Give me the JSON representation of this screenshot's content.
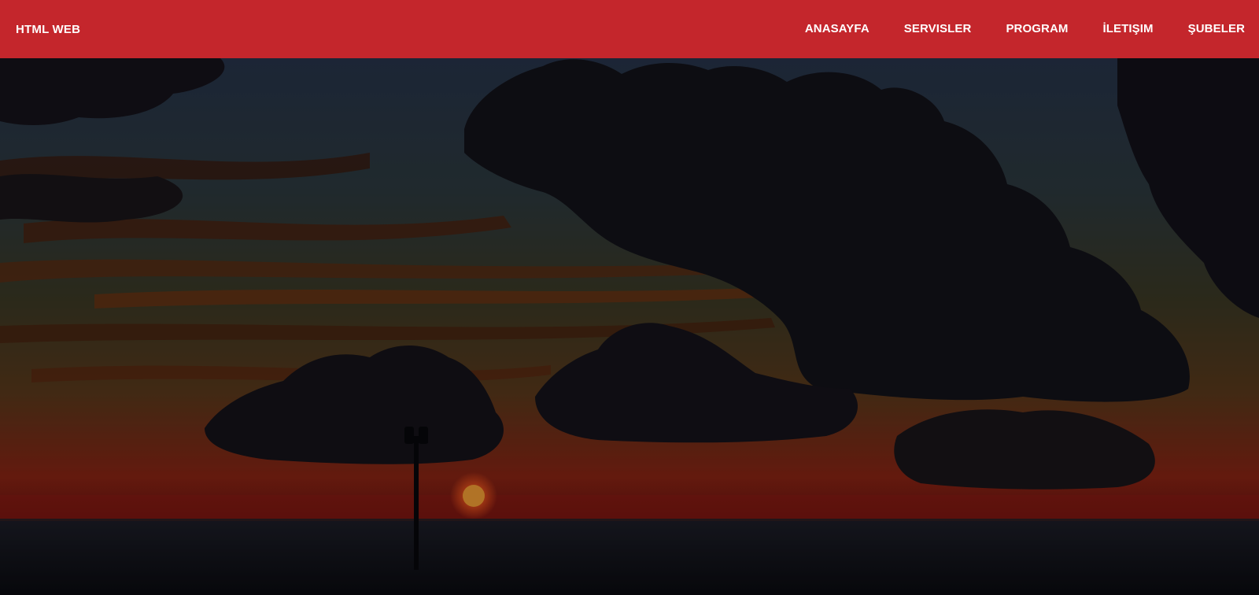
{
  "header": {
    "brand": "HTML WEB",
    "nav": [
      {
        "label": "ANASAYFA"
      },
      {
        "label": "SERVISLER"
      },
      {
        "label": "PROGRAM"
      },
      {
        "label": "İLETIŞIM"
      },
      {
        "label": "ŞUBELER"
      }
    ]
  },
  "hero": {
    "image_subject": "sunset-sky-with-dark-clouds-over-sea",
    "overlay": "dark"
  },
  "colors": {
    "header_bg": "#c4262c",
    "header_text": "#ffffff",
    "sun": "#e04a1a",
    "sky_top": "#2a3a55",
    "horizon": "#8a1f12"
  }
}
